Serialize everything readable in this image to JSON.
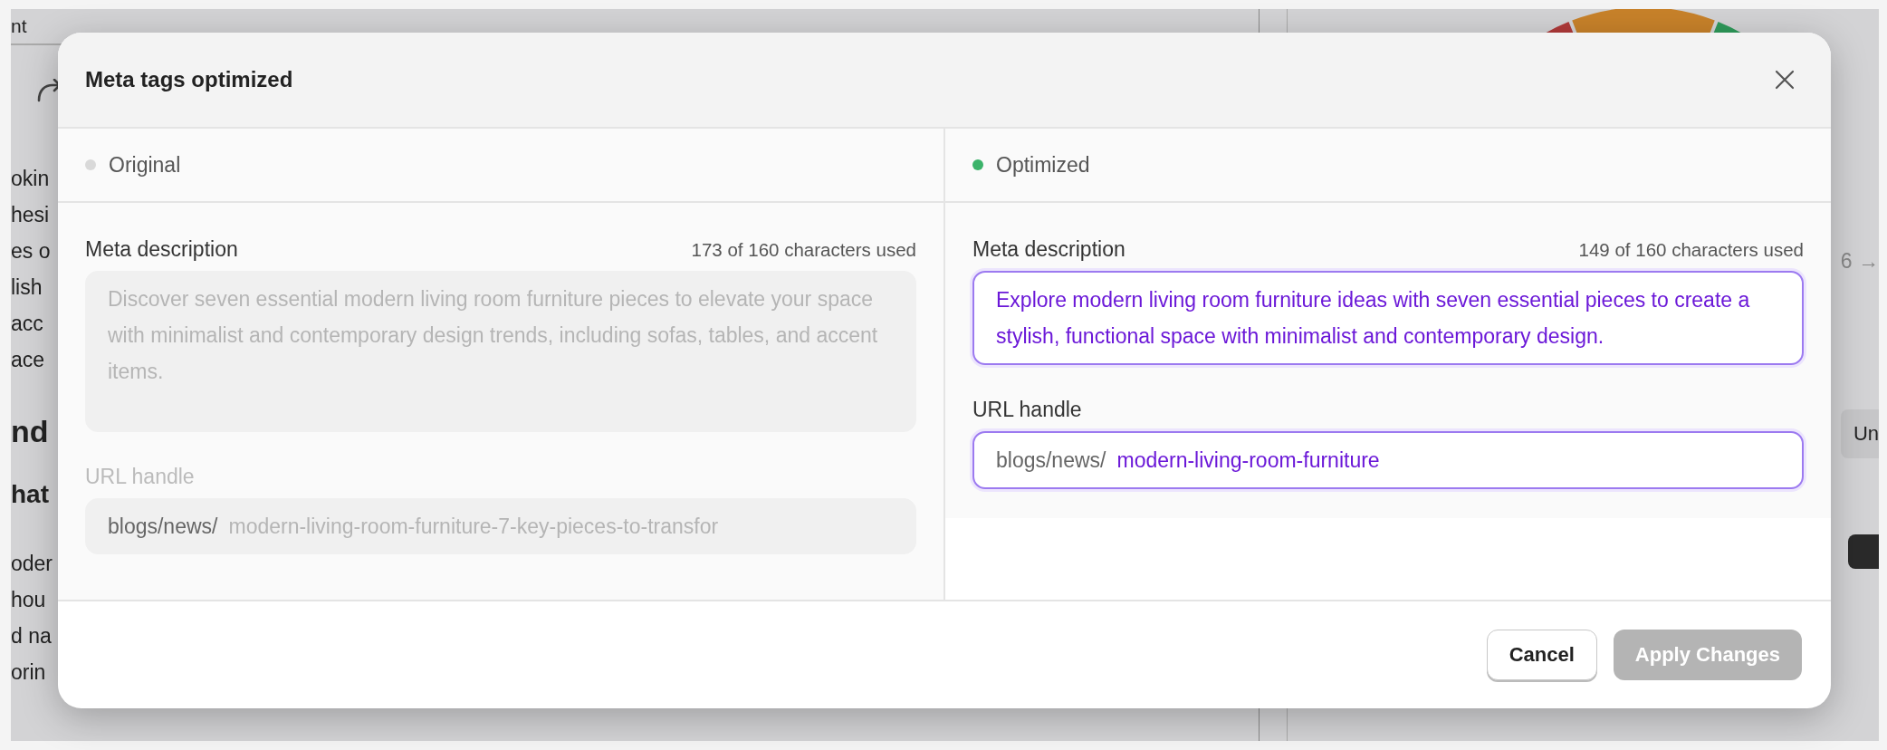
{
  "background": {
    "header_text": "nt",
    "body_lines": [
      "okin",
      "hesi",
      "es o",
      "lish",
      "acc",
      "ace"
    ],
    "heading": "nd",
    "subheading": "hat",
    "body_lines_2": [
      "oder",
      "hou",
      "d na",
      "orin"
    ],
    "side_counter": "6 →",
    "side_chip": "Un"
  },
  "modal": {
    "title": "Meta tags optimized",
    "columns": [
      {
        "label": "Original",
        "color": "#d9d9d9",
        "disabled": true,
        "description_label": "Meta description",
        "char_count": "173 of 160 characters used",
        "description": "Discover seven essential modern living room furniture pieces to elevate your space with minimalist and contemporary design trends, including sofas, tables, and accent items.",
        "url_label": "URL handle",
        "url_prefix": "blogs/news/",
        "url_value": "modern-living-room-furniture-7-key-pieces-to-transfor"
      },
      {
        "label": "Optimized",
        "color": "#3bb36a",
        "disabled": false,
        "description_label": "Meta description",
        "char_count": "149 of 160 characters used",
        "description": "Explore modern living room furniture ideas with seven essential pieces to create a stylish, functional space with minimalist and contemporary design.",
        "url_label": "URL handle",
        "url_prefix": "blogs/news/",
        "url_value": "modern-living-room-furniture"
      }
    ],
    "buttons": [
      {
        "label": "Cancel",
        "disabled": false
      },
      {
        "label": "Apply Changes",
        "disabled": true
      }
    ]
  }
}
